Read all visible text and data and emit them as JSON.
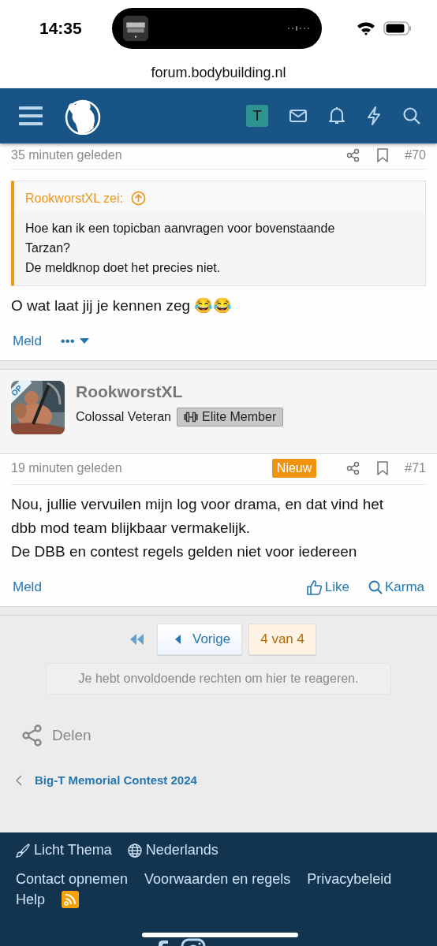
{
  "status_bar": {
    "time": "14:35"
  },
  "browser": {
    "url": "forum.bodybuilding.nl"
  },
  "nav": {
    "account_letter": "T"
  },
  "posts": [
    {
      "time": "35 minuten geleden",
      "number": "#70",
      "quote": {
        "author": "RookworstXL zei:",
        "paragraphs": [
          "Hoe kan ik een topicban aanvragen voor bovenstaande Tarzan?",
          "De meldknop doet het precies niet."
        ]
      },
      "paragraphs": [
        "O wat laat jij je kennen zeg 😂😂"
      ],
      "actions_left": [
        {
          "kind": "link",
          "label": "Meld"
        },
        {
          "kind": "more",
          "label": "•••"
        }
      ]
    },
    {
      "user": {
        "name": "RookworstXL",
        "title": "Colossal Veteran",
        "banner": "Elite Member",
        "op_badge": "OP"
      },
      "time": "19 minuten geleden",
      "number": "#71",
      "new_badge": "Nieuw",
      "paragraphs": [
        "Nou, jullie vervuilen mijn log voor drama, en dat vind het dbb mod team blijkbaar vermakelijk.",
        "De DBB en contest regels gelden niet voor iedereen"
      ],
      "actions_left": [
        {
          "kind": "link",
          "label": "Meld"
        }
      ],
      "actions_right": [
        {
          "kind": "like",
          "label": "Like"
        },
        {
          "kind": "karma",
          "label": "Karma"
        }
      ]
    }
  ],
  "pagination": {
    "previous": "Vorige",
    "pages": [
      {
        "label": "4 van 4",
        "selected": true
      }
    ]
  },
  "notice": "Je hebt onvoldoende rechten om hier te reageren.",
  "share": "Delen",
  "breadcrumb": "Big-T Memorial Contest 2024",
  "footer": {
    "options": [
      {
        "kind": "theme",
        "label": "Licht Thema"
      },
      {
        "kind": "language",
        "label": "Nederlands"
      }
    ],
    "links": [
      "Contact opnemen",
      "Voorwaarden en regels",
      "Privacybeleid",
      "Help"
    ]
  }
}
